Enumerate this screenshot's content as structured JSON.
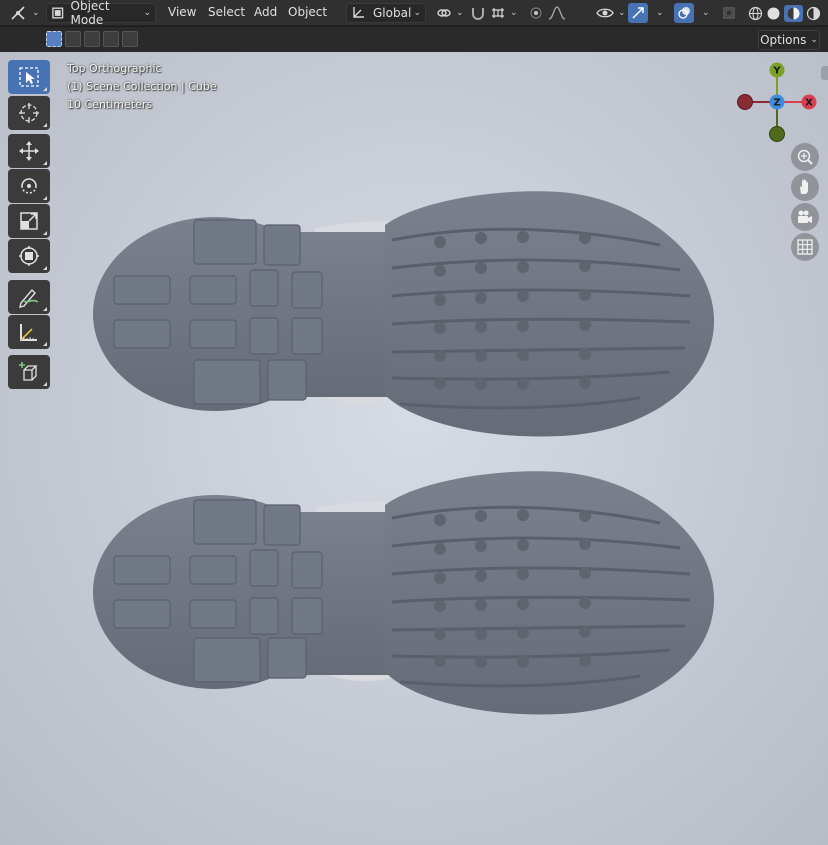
{
  "header": {
    "editor_type_icon": "editor-type-icon",
    "mode_label": "Object Mode",
    "menus": [
      "View",
      "Select",
      "Add",
      "Object"
    ],
    "orientation_label": "Global",
    "options_label": "Options"
  },
  "viewport": {
    "view_name": "Top Orthographic",
    "collection_info": "(1) Scene Collection | Cube",
    "scale_info": "10 Centimeters"
  },
  "gizmo": {
    "axes": [
      "Y",
      "Z",
      "X"
    ],
    "colors": {
      "x": "#d8404f",
      "y": "#7aa12a",
      "z": "#3f8de0",
      "neg_x": "#8a2a33",
      "neg_y": "#4f6a1d"
    }
  },
  "tools": [
    "select-box",
    "cursor",
    "move",
    "rotate",
    "scale",
    "transform",
    "annotate",
    "measure",
    "add-cube"
  ],
  "colors": {
    "accent": "#4772b3",
    "header": "#303030",
    "viewport": "#c8ccd5",
    "mesh": "#6f7682"
  }
}
